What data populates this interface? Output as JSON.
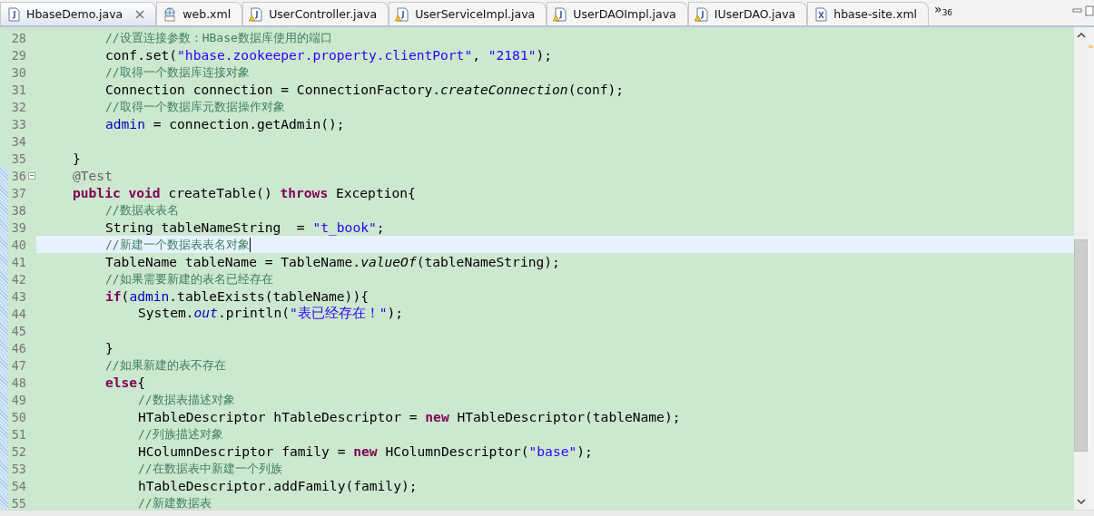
{
  "tabs": [
    {
      "label": "HbaseDemo.java",
      "kind": "java",
      "warning": false,
      "selected": true,
      "closable": true
    },
    {
      "label": "web.xml",
      "kind": "webxml",
      "warning": false,
      "selected": false,
      "closable": false
    },
    {
      "label": "UserController.java",
      "kind": "java",
      "warning": true,
      "selected": false,
      "closable": false
    },
    {
      "label": "UserServiceImpl.java",
      "kind": "java",
      "warning": true,
      "selected": false,
      "closable": false
    },
    {
      "label": "UserDAOImpl.java",
      "kind": "java",
      "warning": true,
      "selected": false,
      "closable": false
    },
    {
      "label": "IUserDAO.java",
      "kind": "java",
      "warning": true,
      "selected": false,
      "closable": false
    },
    {
      "label": "hbase-site.xml",
      "kind": "xml",
      "warning": false,
      "selected": false,
      "closable": false
    }
  ],
  "overflow": {
    "glyph": "»",
    "count": "36"
  },
  "lines": [
    {
      "children": [
        {
          "number": "28",
          "current": false,
          "range": false,
          "foldable": false,
          "tokens": [
            {
              "kind": "comment",
              "text": "//设置连接参数：HBase数据库使用的端口"
            }
          ]
        },
        {
          "number": "29",
          "current": false,
          "range": false,
          "foldable": false,
          "tokens": [
            {
              "kind": "plain",
              "text": "conf.set("
            },
            {
              "kind": "string",
              "text": "\"hbase.zookeeper.property.clientPort\""
            },
            {
              "kind": "plain",
              "text": ", "
            },
            {
              "kind": "string",
              "text": "\"2181\""
            },
            {
              "kind": "plain",
              "text": ");"
            }
          ]
        },
        {
          "number": "30",
          "current": false,
          "range": false,
          "foldable": false,
          "tokens": [
            {
              "kind": "comment",
              "text": "//取得一个数据库连接对象"
            }
          ]
        },
        {
          "number": "31",
          "current": false,
          "range": false,
          "foldable": false,
          "tokens": [
            {
              "kind": "plain",
              "text": "Connection connection = ConnectionFactory."
            },
            {
              "kind": "method",
              "text": "createConnection"
            },
            {
              "kind": "plain",
              "text": "(conf);"
            }
          ]
        },
        {
          "number": "32",
          "current": false,
          "range": false,
          "foldable": false,
          "tokens": [
            {
              "kind": "comment",
              "text": "//取得一个数据库元数据操作对象"
            }
          ]
        },
        {
          "number": "33",
          "current": false,
          "range": false,
          "foldable": false,
          "tokens": [
            {
              "kind": "field",
              "text": "admin"
            },
            {
              "kind": "plain",
              "text": " = connection.getAdmin();"
            }
          ]
        }
      ]
    },
    {
      "number": "34",
      "current": false,
      "range": false,
      "foldable": false
    },
    {
      "number": "35",
      "current": false,
      "range": false,
      "foldable": false,
      "tokens": [
        {
          "kind": "plain",
          "text": "}"
        }
      ]
    },
    {
      "number": "36",
      "current": false,
      "range": true,
      "foldable": true,
      "tokens": [
        {
          "kind": "annotation",
          "text": "@Test"
        }
      ]
    },
    {
      "number": "37",
      "current": false,
      "range": true,
      "foldable": false,
      "tokens": [
        {
          "kind": "keyword",
          "text": "public"
        },
        {
          "kind": "keyword",
          "text": " void"
        },
        {
          "kind": "plain",
          "text": " createTable() "
        },
        {
          "kind": "keyword",
          "text": "throws"
        },
        {
          "kind": "plain",
          "text": " Exception{"
        }
      ],
      "children": [
        {
          "number": "38",
          "current": false,
          "range": true,
          "foldable": false,
          "tokens": [
            {
              "kind": "comment",
              "text": "//数据表表名"
            }
          ]
        },
        {
          "number": "39",
          "current": false,
          "range": true,
          "foldable": false,
          "tokens": [
            {
              "kind": "plain",
              "text": "String tableNameString  = "
            },
            {
              "kind": "string",
              "text": "\"t_book\""
            },
            {
              "kind": "plain",
              "text": ";"
            }
          ]
        },
        {
          "number": "40",
          "current": true,
          "range": true,
          "foldable": false,
          "tokens": [
            {
              "kind": "comment",
              "text": "//新建一个数据表表名对象"
            }
          ]
        },
        {
          "number": "41",
          "current": false,
          "range": true,
          "foldable": false,
          "tokens": [
            {
              "kind": "plain",
              "text": "TableName tableName = TableName."
            },
            {
              "kind": "method",
              "text": "valueOf"
            },
            {
              "kind": "plain",
              "text": "(tableNameString);"
            }
          ]
        },
        {
          "number": "42",
          "current": false,
          "range": true,
          "foldable": false,
          "tokens": [
            {
              "kind": "comment",
              "text": "//如果需要新建的表名已经存在"
            }
          ]
        },
        {
          "number": "43",
          "current": false,
          "range": true,
          "foldable": false,
          "tokens": [
            {
              "kind": "keyword",
              "text": "if"
            },
            {
              "kind": "plain",
              "text": "("
            },
            {
              "kind": "field",
              "text": "admin"
            },
            {
              "kind": "plain",
              "text": ".tableExists(tableName)){"
            }
          ],
          "children": [
            {
              "number": "44",
              "current": false,
              "range": true,
              "foldable": false,
              "tokens": [
                {
                  "kind": "plain",
                  "text": "System."
                },
                {
                  "kind": "static",
                  "text": "out"
                },
                {
                  "kind": "plain",
                  "text": ".println("
                },
                {
                  "kind": "string",
                  "text": "\"表已经存在！\""
                },
                {
                  "kind": "plain",
                  "text": ");"
                }
              ]
            },
            {
              "number": "45",
              "current": false,
              "range": true,
              "foldable": false
            }
          ]
        },
        {
          "number": "46",
          "current": false,
          "range": true,
          "foldable": false,
          "tokens": [
            {
              "kind": "plain",
              "text": "}"
            }
          ]
        },
        {
          "number": "47",
          "current": false,
          "range": true,
          "foldable": false,
          "tokens": [
            {
              "kind": "comment",
              "text": "//如果新建的表不存在"
            }
          ]
        },
        {
          "number": "48",
          "current": false,
          "range": true,
          "foldable": false,
          "tokens": [
            {
              "kind": "keyword",
              "text": "else"
            },
            {
              "kind": "plain",
              "text": "{"
            }
          ],
          "children": [
            {
              "number": "49",
              "current": false,
              "range": true,
              "foldable": false,
              "tokens": [
                {
                  "kind": "comment",
                  "text": "//数据表描述对象"
                }
              ]
            },
            {
              "number": "50",
              "current": false,
              "range": true,
              "foldable": false,
              "tokens": [
                {
                  "kind": "plain",
                  "text": "HTableDescriptor hTableDescriptor = "
                },
                {
                  "kind": "keyword",
                  "text": "new"
                },
                {
                  "kind": "plain",
                  "text": " HTableDescriptor(tableName);"
                }
              ]
            },
            {
              "number": "51",
              "current": false,
              "range": true,
              "foldable": false,
              "tokens": [
                {
                  "kind": "comment",
                  "text": "//列族描述对象"
                }
              ]
            },
            {
              "number": "52",
              "current": false,
              "range": true,
              "foldable": false,
              "tokens": [
                {
                  "kind": "plain",
                  "text": "HColumnDescriptor family = "
                },
                {
                  "kind": "keyword",
                  "text": "new"
                },
                {
                  "kind": "plain",
                  "text": " HColumnDescriptor("
                },
                {
                  "kind": "string",
                  "text": "\"base\""
                },
                {
                  "kind": "plain",
                  "text": ");"
                }
              ]
            },
            {
              "number": "53",
              "current": false,
              "range": true,
              "foldable": false,
              "tokens": [
                {
                  "kind": "comment",
                  "text": "//在数据表中新建一个列族"
                }
              ]
            },
            {
              "number": "54",
              "current": false,
              "range": true,
              "foldable": false,
              "tokens": [
                {
                  "kind": "plain",
                  "text": "hTableDescriptor.addFamily(family);"
                }
              ]
            },
            {
              "number": "55",
              "current": false,
              "range": true,
              "foldable": false,
              "tokens": [
                {
                  "kind": "comment",
                  "text": "//新建数据表"
                }
              ]
            }
          ]
        }
      ]
    }
  ]
}
